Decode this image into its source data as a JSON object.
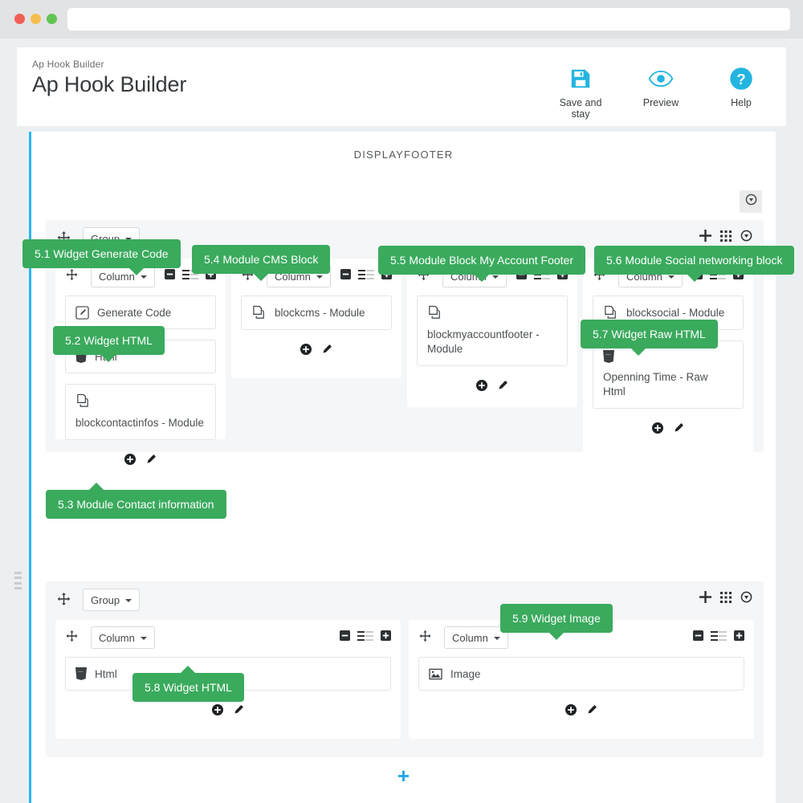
{
  "browser": {
    "dots": [
      "close-red",
      "minimize-yellow",
      "maximize-green"
    ],
    "url_value": ""
  },
  "header": {
    "breadcrumb": "Ap Hook Builder",
    "title": "Ap Hook Builder",
    "actions": [
      {
        "icon": "save-icon",
        "label": "Save and stay"
      },
      {
        "icon": "eye-icon",
        "label": "Preview"
      },
      {
        "icon": "help-circle-icon",
        "label": "Help"
      }
    ],
    "accent_color": "#23b5e0"
  },
  "builder": {
    "hook_name": "DISPLAYFOOTER",
    "hook_toggle_icon": "circle-down-arrow-icon",
    "add_row_label": "+",
    "accent_color": "#29b6f6",
    "tooltip_color": "#3aaa5d",
    "groups": [
      {
        "type_label": "Group",
        "tools": [
          "plus-icon",
          "grid-icon",
          "circle-down-arrow-icon"
        ],
        "columns": [
          {
            "type_label": "Column",
            "tools": [
              "minus-square-icon",
              "resize-bars-icon",
              "plus-square-icon"
            ],
            "widgets": [
              {
                "icon": "edit-square-icon",
                "label": "Generate  Code",
                "layout": "inline"
              },
              {
                "icon": "html5-icon",
                "label": "Html",
                "layout": "inline"
              },
              {
                "icon": "copy-module-icon",
                "label": "blockcontactinfos - Module",
                "layout": "stacked"
              }
            ],
            "footer_icons": [
              "plus-circle-icon",
              "pencil-icon"
            ]
          },
          {
            "type_label": "Column",
            "tools": [
              "minus-square-icon",
              "resize-bars-icon",
              "plus-square-icon"
            ],
            "widgets": [
              {
                "icon": "copy-module-icon",
                "label": "blockcms  -  Module",
                "layout": "inline"
              }
            ],
            "footer_icons": [
              "plus-circle-icon",
              "pencil-icon"
            ]
          },
          {
            "type_label": "Column",
            "tools": [
              "minus-square-icon",
              "resize-bars-icon",
              "plus-square-icon"
            ],
            "widgets": [
              {
                "icon": "copy-module-icon",
                "label": "blockmyaccountfooter - Module",
                "layout": "stacked"
              }
            ],
            "footer_icons": [
              "plus-circle-icon",
              "pencil-icon"
            ]
          },
          {
            "type_label": "Column",
            "tools": [
              "minus-square-icon",
              "resize-bars-icon",
              "plus-square-icon"
            ],
            "widgets": [
              {
                "icon": "copy-module-icon",
                "label": "blocksocial  -  Module",
                "layout": "inline"
              },
              {
                "icon": "html5-icon",
                "label": "Openning Time - Raw Html",
                "layout": "stacked"
              }
            ],
            "footer_icons": [
              "plus-circle-icon",
              "pencil-icon"
            ]
          }
        ]
      },
      {
        "type_label": "Group",
        "tools": [
          "plus-icon",
          "grid-icon",
          "circle-down-arrow-icon"
        ],
        "columns": [
          {
            "type_label": "Column",
            "tools": [
              "minus-square-icon",
              "resize-bars-icon",
              "plus-square-icon"
            ],
            "widgets": [
              {
                "icon": "html5-icon",
                "label": "Html",
                "layout": "inline"
              }
            ],
            "footer_icons": [
              "plus-circle-icon",
              "pencil-icon"
            ]
          },
          {
            "type_label": "Column",
            "tools": [
              "minus-square-icon",
              "resize-bars-icon",
              "plus-square-icon"
            ],
            "widgets": [
              {
                "icon": "image-icon",
                "label": "Image",
                "layout": "inline"
              }
            ],
            "footer_icons": [
              "plus-circle-icon",
              "pencil-icon"
            ]
          }
        ]
      }
    ],
    "annotations": [
      {
        "id": "5.1",
        "text": "5.1 Widget Generate Code",
        "arrow": "down"
      },
      {
        "id": "5.2",
        "text": "5.2 Widget HTML",
        "arrow": "down"
      },
      {
        "id": "5.3",
        "text": "5.3 Module Contact information",
        "arrow": "up"
      },
      {
        "id": "5.4",
        "text": "5.4 Module CMS Block",
        "arrow": "down"
      },
      {
        "id": "5.5",
        "text": "5.5 Module Block My Account Footer",
        "arrow": "down"
      },
      {
        "id": "5.6",
        "text": "5.6 Module Social networking block",
        "arrow": "down"
      },
      {
        "id": "5.7",
        "text": "5.7 Widget Raw HTML",
        "arrow": "down"
      },
      {
        "id": "5.8",
        "text": "5.8 Widget HTML",
        "arrow": "up"
      },
      {
        "id": "5.9",
        "text": "5.9 Widget Image",
        "arrow": "down"
      }
    ]
  }
}
